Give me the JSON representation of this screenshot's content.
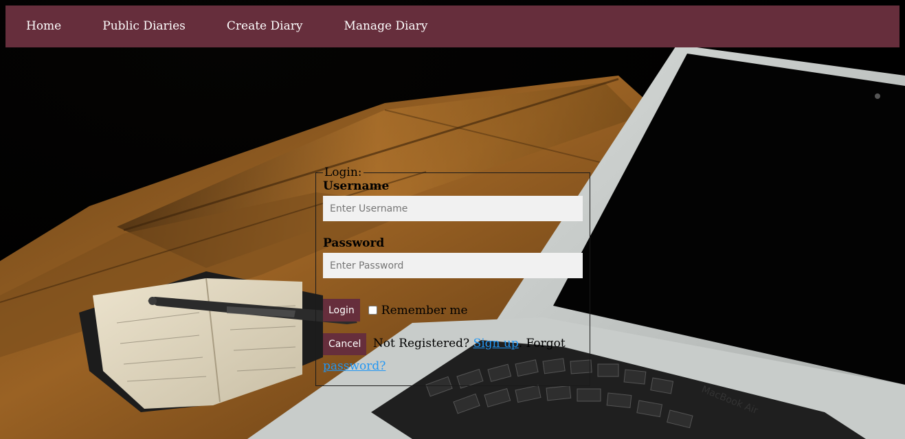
{
  "nav": {
    "items": [
      {
        "label": "Home"
      },
      {
        "label": "Public Diaries"
      },
      {
        "label": "Create Diary"
      },
      {
        "label": "Manage Diary"
      }
    ],
    "bg_color": "#662e3c"
  },
  "login": {
    "legend": "Login:",
    "username_label": "Username",
    "username_placeholder": "Enter Username",
    "password_label": "Password",
    "password_placeholder": "Enter Password",
    "login_button": "Login",
    "remember_label": "Remember me",
    "cancel_button": "Cancel",
    "not_registered_text": "Not Registered?",
    "signup_link": "Sign up",
    "separator_text": ".",
    "forgot_text": "Forgot",
    "forgot_link": "password?",
    "link_color": "#2196f3"
  },
  "background": {
    "laptop_brand": "MacBook Air",
    "description_icons": [
      "notebook",
      "pen",
      "laptop",
      "wooden-desk"
    ]
  }
}
